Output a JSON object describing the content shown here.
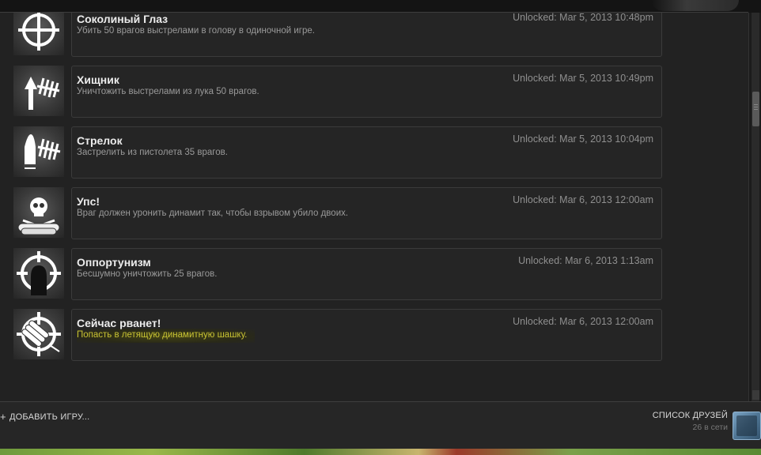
{
  "achievements": [
    {
      "title": "Соколиный Глаз",
      "description": "Убить 50 врагов выстрелами в голову в одиночной игре.",
      "unlocked": "Unlocked: Mar 5, 2013 10:48pm",
      "icon": "crosshair-icon",
      "highlighted": false
    },
    {
      "title": "Хищник",
      "description": "Уничтожить выстрелами из лука 50 врагов.",
      "unlocked": "Unlocked: Mar 5, 2013 10:49pm",
      "icon": "arrow-tally-icon",
      "highlighted": false
    },
    {
      "title": "Стрелок",
      "description": "Застрелить из пистолета 35 врагов.",
      "unlocked": "Unlocked: Mar 5, 2013 10:04pm",
      "icon": "bullet-tally-icon",
      "highlighted": false
    },
    {
      "title": "Упс!",
      "description": "Враг должен уронить динамит так, чтобы взрывом убило двоих.",
      "unlocked": "Unlocked: Mar 6, 2013 12:00am",
      "icon": "skull-dynamite-icon",
      "highlighted": false
    },
    {
      "title": "Оппортунизм",
      "description": "Бесшумно уничтожить 25 врагов.",
      "unlocked": "Unlocked: Mar 6, 2013 1:13am",
      "icon": "silhouette-crosshair-icon",
      "highlighted": false
    },
    {
      "title": "Сейчас рванет!",
      "description": "Попасть в летящую динамитную шашку.",
      "unlocked": "Unlocked: Mar 6, 2013 12:00am",
      "icon": "dynamite-crosshair-icon",
      "highlighted": true
    }
  ],
  "footer": {
    "add_game": "ДОБАВИТЬ ИГРУ...",
    "friends_label": "СПИСОК ДРУЗЕЙ",
    "friends_online": "26 в сети"
  },
  "colors": {
    "highlight_text": "#c8c233",
    "card_border": "#3b3b3b",
    "background": "#222222"
  }
}
